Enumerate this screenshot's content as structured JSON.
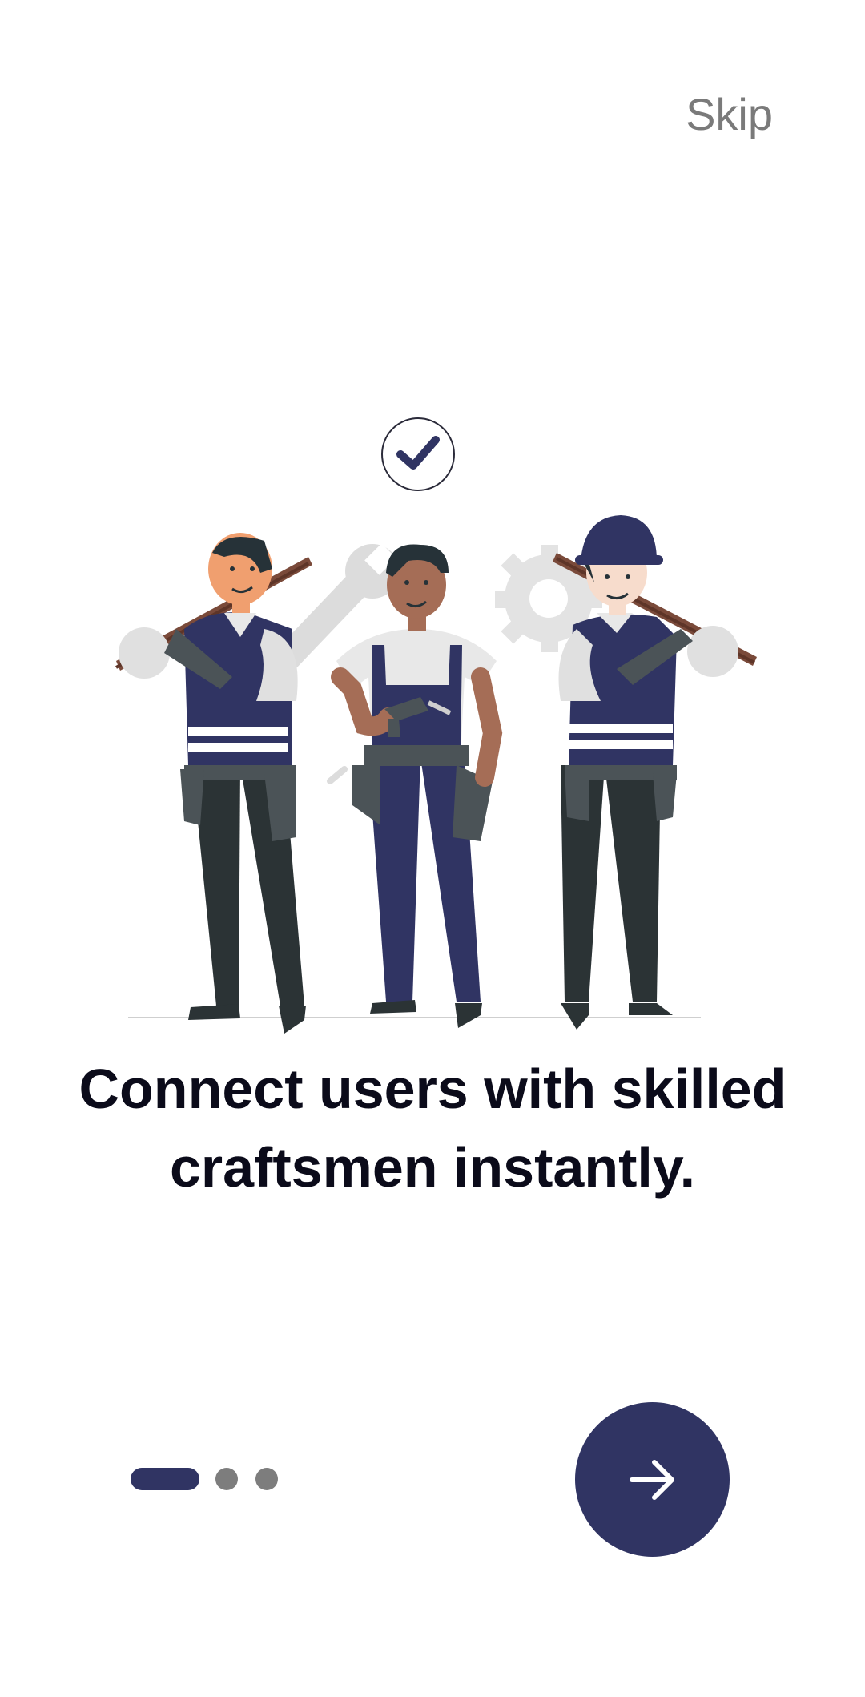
{
  "header": {
    "skip_label": "Skip"
  },
  "onboarding": {
    "headline_line1": "Connect users with skilled",
    "headline_line2": "craftsmen instantly.",
    "illustration_icon": "three-craftsmen-illustration",
    "check_icon": "checkmark-icon"
  },
  "pager": {
    "total_pages": 3,
    "current_page": 1
  },
  "next_button": {
    "icon": "arrow-right-icon"
  },
  "colors": {
    "accent": "#303463",
    "inactive_dot": "#7d7d7d",
    "skip_text": "#7a7a7a",
    "headline_text": "#0b0b1a",
    "background": "#ffffff"
  }
}
